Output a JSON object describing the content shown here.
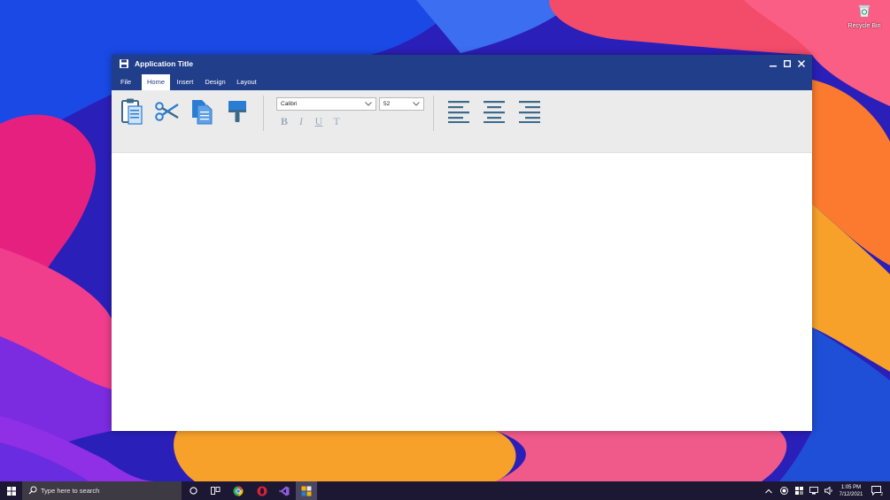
{
  "desktop": {
    "recycle_bin_label": "Recycle Bin"
  },
  "window": {
    "title": "Application Title",
    "tabs": [
      {
        "label": "File",
        "active": false
      },
      {
        "label": "Home",
        "active": true
      },
      {
        "label": "Insert",
        "active": false
      },
      {
        "label": "Design",
        "active": false
      },
      {
        "label": "Layout",
        "active": false
      }
    ],
    "ribbon": {
      "clipboard_buttons": [
        "paste-icon",
        "cut-icon",
        "copy-icon",
        "format-painter-icon"
      ],
      "font_family": "Calibri",
      "font_size": "52",
      "format_buttons": [
        {
          "name": "bold",
          "glyph": "B"
        },
        {
          "name": "italic",
          "glyph": "I"
        },
        {
          "name": "underline",
          "glyph": "U"
        },
        {
          "name": "strikethrough",
          "glyph": "T"
        }
      ],
      "align_buttons": [
        "align-left-icon",
        "align-center-icon",
        "align-right-icon"
      ]
    }
  },
  "taskbar": {
    "search_placeholder": "Type here to search",
    "time": "1:05 PM",
    "date": "7/12/2021",
    "notification_count": "2"
  },
  "colors": {
    "titlebar": "#213e8a",
    "ribbon": "#ebebeb",
    "icon_blue": "#2b7cd3",
    "icon_dark": "#3d6a8a",
    "taskbar": "#1c1733"
  }
}
